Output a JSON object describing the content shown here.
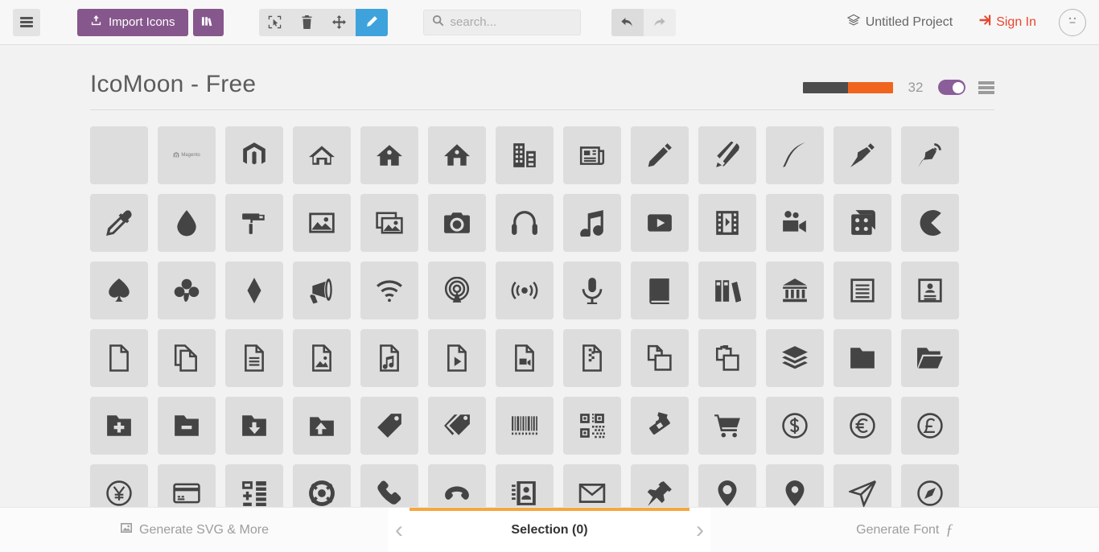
{
  "toolbar": {
    "menu_icon": "hamburger-icon",
    "import_label": "Import Icons",
    "import_icon": "upload-icon",
    "library_icon": "library-icon",
    "tools": [
      {
        "name": "select-tool",
        "icon": "cursor-select-icon",
        "active": false
      },
      {
        "name": "delete-tool",
        "icon": "trash-icon",
        "active": false
      },
      {
        "name": "move-tool",
        "icon": "move-arrows-icon",
        "active": false
      },
      {
        "name": "edit-tool",
        "icon": "pencil-icon",
        "active": true
      }
    ],
    "search_placeholder": "search...",
    "search_value": "",
    "search_icon": "search-icon",
    "undo_icon": "undo-arrow-icon",
    "redo_icon": "redo-arrow-icon",
    "project_label": "Untitled Project",
    "project_icon": "layers-icon",
    "signin_label": "Sign In",
    "signin_icon": "login-icon",
    "avatar_icon": "neutral-face-icon",
    "accent_active": "#3ea3dc",
    "accent_purple": "#86578c",
    "accent_red": "#e8462f"
  },
  "set": {
    "title": "IcoMoon - Free",
    "size_value": "32",
    "slider_dark": "#4d4d4d",
    "slider_orange": "#f1641e",
    "toggle_on": true,
    "toggle_color": "#8a5e99",
    "list_menu_icon": "list-menu-icon"
  },
  "grid": {
    "icons": [
      {
        "name": "blank",
        "label": ""
      },
      {
        "name": "magento-wordmark",
        "label": "Magento"
      },
      {
        "name": "magento-mark",
        "label": ""
      },
      {
        "name": "home",
        "label": ""
      },
      {
        "name": "home2",
        "label": ""
      },
      {
        "name": "home3",
        "label": ""
      },
      {
        "name": "office",
        "label": ""
      },
      {
        "name": "newspaper",
        "label": ""
      },
      {
        "name": "pencil",
        "label": ""
      },
      {
        "name": "pencil2",
        "label": ""
      },
      {
        "name": "quill",
        "label": ""
      },
      {
        "name": "pen",
        "label": ""
      },
      {
        "name": "blog",
        "label": ""
      },
      {
        "name": "eyedropper",
        "label": ""
      },
      {
        "name": "droplet",
        "label": ""
      },
      {
        "name": "paint-format",
        "label": ""
      },
      {
        "name": "image",
        "label": ""
      },
      {
        "name": "images",
        "label": ""
      },
      {
        "name": "camera",
        "label": ""
      },
      {
        "name": "headphones",
        "label": ""
      },
      {
        "name": "music",
        "label": ""
      },
      {
        "name": "play",
        "label": ""
      },
      {
        "name": "film",
        "label": ""
      },
      {
        "name": "video-camera",
        "label": ""
      },
      {
        "name": "dice",
        "label": ""
      },
      {
        "name": "pacman",
        "label": ""
      },
      {
        "name": "spades",
        "label": ""
      },
      {
        "name": "clubs",
        "label": ""
      },
      {
        "name": "diamonds",
        "label": ""
      },
      {
        "name": "bullhorn",
        "label": ""
      },
      {
        "name": "connection",
        "label": ""
      },
      {
        "name": "podcast",
        "label": ""
      },
      {
        "name": "feed",
        "label": ""
      },
      {
        "name": "mic",
        "label": ""
      },
      {
        "name": "book",
        "label": ""
      },
      {
        "name": "books",
        "label": ""
      },
      {
        "name": "library",
        "label": ""
      },
      {
        "name": "file-text",
        "label": ""
      },
      {
        "name": "profile",
        "label": ""
      },
      {
        "name": "file-empty",
        "label": ""
      },
      {
        "name": "files-empty",
        "label": ""
      },
      {
        "name": "file-text2",
        "label": ""
      },
      {
        "name": "file-picture",
        "label": ""
      },
      {
        "name": "file-music",
        "label": ""
      },
      {
        "name": "file-play",
        "label": ""
      },
      {
        "name": "file-video",
        "label": ""
      },
      {
        "name": "file-zip",
        "label": ""
      },
      {
        "name": "copy",
        "label": ""
      },
      {
        "name": "paste",
        "label": ""
      },
      {
        "name": "stack",
        "label": ""
      },
      {
        "name": "folder",
        "label": ""
      },
      {
        "name": "folder-open",
        "label": ""
      },
      {
        "name": "folder-plus",
        "label": ""
      },
      {
        "name": "folder-minus",
        "label": ""
      },
      {
        "name": "folder-download",
        "label": ""
      },
      {
        "name": "folder-upload",
        "label": ""
      },
      {
        "name": "price-tag",
        "label": ""
      },
      {
        "name": "price-tags",
        "label": ""
      },
      {
        "name": "barcode",
        "label": ""
      },
      {
        "name": "qrcode",
        "label": ""
      },
      {
        "name": "ticket",
        "label": ""
      },
      {
        "name": "cart",
        "label": ""
      },
      {
        "name": "coin-dollar",
        "label": ""
      },
      {
        "name": "coin-euro",
        "label": ""
      },
      {
        "name": "coin-pound",
        "label": ""
      },
      {
        "name": "coin-yen",
        "label": ""
      },
      {
        "name": "credit-card",
        "label": ""
      },
      {
        "name": "calculator",
        "label": ""
      },
      {
        "name": "lifebuoy",
        "label": ""
      },
      {
        "name": "phone",
        "label": ""
      },
      {
        "name": "phone-hang-up",
        "label": ""
      },
      {
        "name": "address-book",
        "label": ""
      },
      {
        "name": "envelop",
        "label": ""
      },
      {
        "name": "pushpin",
        "label": ""
      },
      {
        "name": "location",
        "label": ""
      },
      {
        "name": "location2",
        "label": ""
      },
      {
        "name": "compass",
        "label": ""
      },
      {
        "name": "compass2",
        "label": ""
      }
    ]
  },
  "bottom": {
    "left_label": "Generate SVG & More",
    "left_icon": "image-icon",
    "center_label": "Selection (0)",
    "right_label": "Generate Font",
    "right_icon": "font-f-icon",
    "chevron_left": "‹",
    "chevron_right": "›",
    "accent_orange": "#f5a742"
  }
}
